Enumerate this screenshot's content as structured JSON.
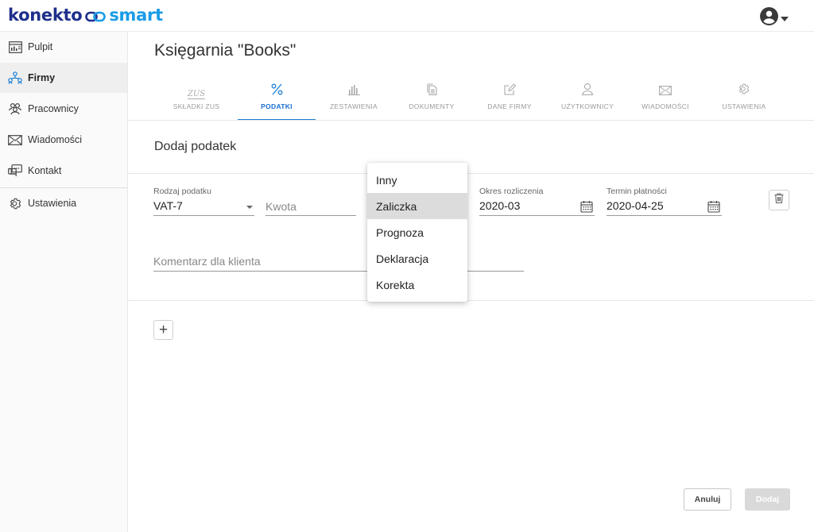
{
  "header": {
    "logo_brand": "konekto",
    "logo_smart": "smart",
    "user_icon": "account-circle-icon"
  },
  "sidebar": {
    "items": [
      {
        "label": "Pulpit",
        "icon": "dashboard-icon"
      },
      {
        "label": "Firmy",
        "icon": "companies-icon",
        "active": true
      },
      {
        "label": "Pracownicy",
        "icon": "employees-icon"
      },
      {
        "label": "Wiadomości",
        "icon": "envelope-icon"
      },
      {
        "label": "Kontakt",
        "icon": "contact-icon"
      },
      {
        "label": "Ustawienia",
        "icon": "gear-icon"
      }
    ]
  },
  "main": {
    "title": "Księgarnia \"Books\"",
    "tabs": [
      {
        "label": "SKŁADKI ZUS",
        "icon_text": "ZUS",
        "icon": "zus-icon"
      },
      {
        "label": "PODATKI",
        "icon": "percent-icon",
        "active": true
      },
      {
        "label": "ZESTAWIENIA",
        "icon": "bar-chart-icon"
      },
      {
        "label": "DOKUMENTY",
        "icon": "documents-icon"
      },
      {
        "label": "DANE FIRMY",
        "icon": "edit-icon"
      },
      {
        "label": "UŻYTKOWNICY",
        "icon": "user-icon"
      },
      {
        "label": "WIADOMOŚCI",
        "icon": "envelope-icon"
      },
      {
        "label": "USTAWIENIA",
        "icon": "gear-icon"
      }
    ]
  },
  "form": {
    "section_title": "Dodaj podatek",
    "tax_type": {
      "label": "Rodzaj podatku",
      "value": "VAT-7"
    },
    "amount": {
      "placeholder": "Kwota"
    },
    "period": {
      "label": "Okres rozliczenia",
      "value": "2020-03"
    },
    "due_date": {
      "label": "Termin płatności",
      "value": "2020-04-25"
    },
    "comment": {
      "placeholder": "Komentarz dla klienta"
    },
    "add_row_symbol": "+"
  },
  "dropdown": {
    "options": [
      "Inny",
      "Zaliczka",
      "Prognoza",
      "Deklaracja",
      "Korekta"
    ],
    "selected": "Zaliczka"
  },
  "actions": {
    "cancel_label": "Anuluj",
    "submit_label": "Dodaj"
  },
  "colors": {
    "brand_dark": "#1e2f8c",
    "brand_light": "#1a9be6",
    "accent_tab": "#1a7fd6"
  }
}
